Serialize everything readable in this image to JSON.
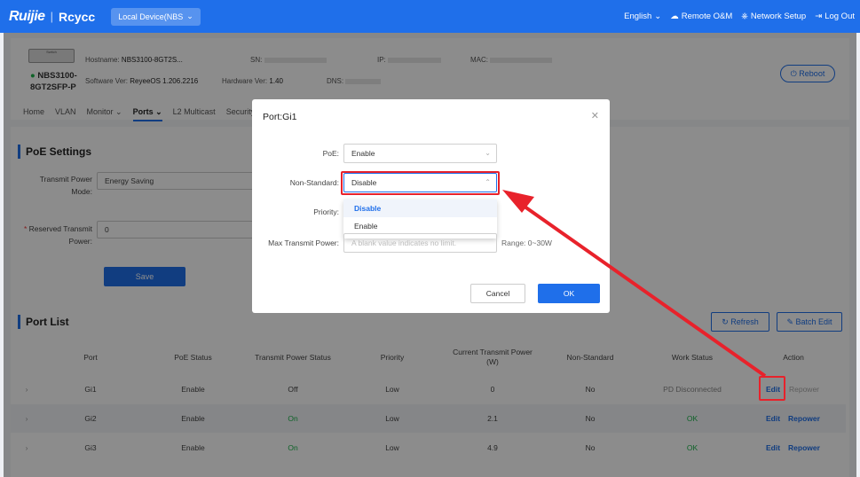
{
  "topbar": {
    "logo": "Ruijie",
    "logo2": "Rcycc",
    "device_selector": "Local Device(NBS",
    "language": "English",
    "remote": "Remote O&M",
    "network_setup": "Network Setup",
    "logout": "Log Out"
  },
  "device": {
    "image_label": "Switch",
    "model_line1": "NBS3100-",
    "model_line2": "8GT2SFP-P",
    "hostname_label": "Hostname:",
    "hostname_value": "NBS3100-8GT2S...",
    "software_label": "Software Ver:",
    "software_value": "ReyeeOS 1.206.2216",
    "sn_label": "SN:",
    "hardware_label": "Hardware Ver:",
    "hardware_value": "1.40",
    "ip_label": "IP:",
    "dns_label": "DNS:",
    "mac_label": "MAC:",
    "reboot": "Reboot"
  },
  "tabs": [
    "Home",
    "VLAN",
    "Monitor",
    "Ports",
    "L2 Multicast",
    "Security"
  ],
  "poe_settings": {
    "title": "PoE Settings",
    "mode_label_1": "Transmit Power",
    "mode_label_2": "Mode:",
    "mode_value": "Energy Saving",
    "reserved_label_1": "Reserved Transmit",
    "reserved_label_2": "Power:",
    "reserved_value": "0",
    "save": "Save"
  },
  "port_list": {
    "title": "Port List",
    "refresh": "Refresh",
    "batch_edit": "Batch Edit",
    "headers": [
      "Port",
      "PoE Status",
      "Transmit Power Status",
      "Priority",
      "Current Transmit Power (W)",
      "Non-Standard",
      "Work Status",
      "Action"
    ],
    "rows": [
      {
        "port": "Gi1",
        "poe": "Enable",
        "tps": "Off",
        "priority": "Low",
        "power": "0",
        "nonstd": "No",
        "work": "PD Disconnected",
        "edit": "Edit",
        "repower": "Repower"
      },
      {
        "port": "Gi2",
        "poe": "Enable",
        "tps": "On",
        "priority": "Low",
        "power": "2.1",
        "nonstd": "No",
        "work": "OK",
        "edit": "Edit",
        "repower": "Repower"
      },
      {
        "port": "Gi3",
        "poe": "Enable",
        "tps": "On",
        "priority": "Low",
        "power": "4.9",
        "nonstd": "No",
        "work": "OK",
        "edit": "Edit",
        "repower": "Repower"
      }
    ]
  },
  "modal": {
    "title": "Port:Gi1",
    "poe_label": "PoE:",
    "poe_value": "Enable",
    "nonstd_label": "Non-Standard:",
    "nonstd_value": "Disable",
    "priority_label": "Priority:",
    "options": [
      "Disable",
      "Enable"
    ],
    "max_power_label": "Max Transmit Power:",
    "max_power_placeholder": "A blank value indicates no limit.",
    "range_hint": "Range: 0~30W",
    "cancel": "Cancel",
    "ok": "OK"
  },
  "colors": {
    "primary": "#1f6fea",
    "annotation": "#e8222b",
    "ok": "#1bb34a"
  }
}
